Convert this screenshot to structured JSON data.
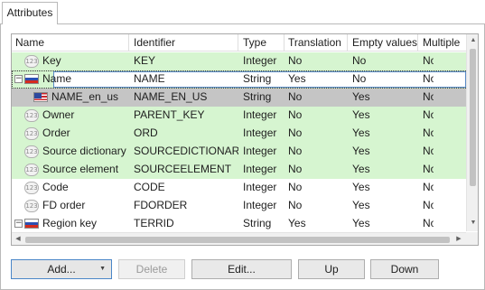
{
  "tabs": [
    {
      "label": "Attributes"
    }
  ],
  "columns": [
    "Name",
    "Identifier",
    "Type",
    "Translation",
    "Empty values",
    "Multiple"
  ],
  "rows": [
    {
      "name": "Key",
      "identifier": "KEY",
      "type": "Integer",
      "translation": "No",
      "empty_values": "No",
      "multiple": "No",
      "icon": "integer-123-icon"
    },
    {
      "name": "Name",
      "identifier": "NAME",
      "type": "String",
      "translation": "Yes",
      "empty_values": "No",
      "multiple": "No",
      "icon": "russian-flag-icon",
      "expander": "−"
    },
    {
      "name": "NAME_en_us",
      "identifier": "NAME_EN_US",
      "type": "String",
      "translation": "No",
      "empty_values": "Yes",
      "multiple": "No",
      "icon": "us-flag-icon"
    },
    {
      "name": "Owner",
      "identifier": "PARENT_KEY",
      "type": "Integer",
      "translation": "No",
      "empty_values": "Yes",
      "multiple": "No",
      "icon": "integer-123-icon"
    },
    {
      "name": "Order",
      "identifier": "ORD",
      "type": "Integer",
      "translation": "No",
      "empty_values": "Yes",
      "multiple": "No",
      "icon": "integer-123-icon"
    },
    {
      "name": "Source dictionary",
      "identifier": "SOURCEDICTIONARY",
      "type": "Integer",
      "translation": "No",
      "empty_values": "Yes",
      "multiple": "No",
      "icon": "integer-123-icon"
    },
    {
      "name": "Source element",
      "identifier": "SOURCEELEMENT",
      "type": "Integer",
      "translation": "No",
      "empty_values": "Yes",
      "multiple": "No",
      "icon": "integer-123-icon"
    },
    {
      "name": "Code",
      "identifier": "CODE",
      "type": "Integer",
      "translation": "No",
      "empty_values": "Yes",
      "multiple": "No",
      "icon": "integer-123-icon"
    },
    {
      "name": "FD order",
      "identifier": "FDORDER",
      "type": "Integer",
      "translation": "No",
      "empty_values": "Yes",
      "multiple": "No",
      "icon": "integer-123-icon"
    },
    {
      "name": "Region key",
      "identifier": "TERRID",
      "type": "String",
      "translation": "Yes",
      "empty_values": "Yes",
      "multiple": "No",
      "icon": "russian-flag-icon",
      "expander": "−"
    }
  ],
  "icon_text": "123",
  "buttons": {
    "add": "Add...",
    "delete": "Delete",
    "edit": "Edit...",
    "up": "Up",
    "down": "Down"
  },
  "colors": {
    "row_green": "#d6f5d0",
    "row_selected": "#c5c5c5",
    "focus_border": "#5a8ac6"
  }
}
